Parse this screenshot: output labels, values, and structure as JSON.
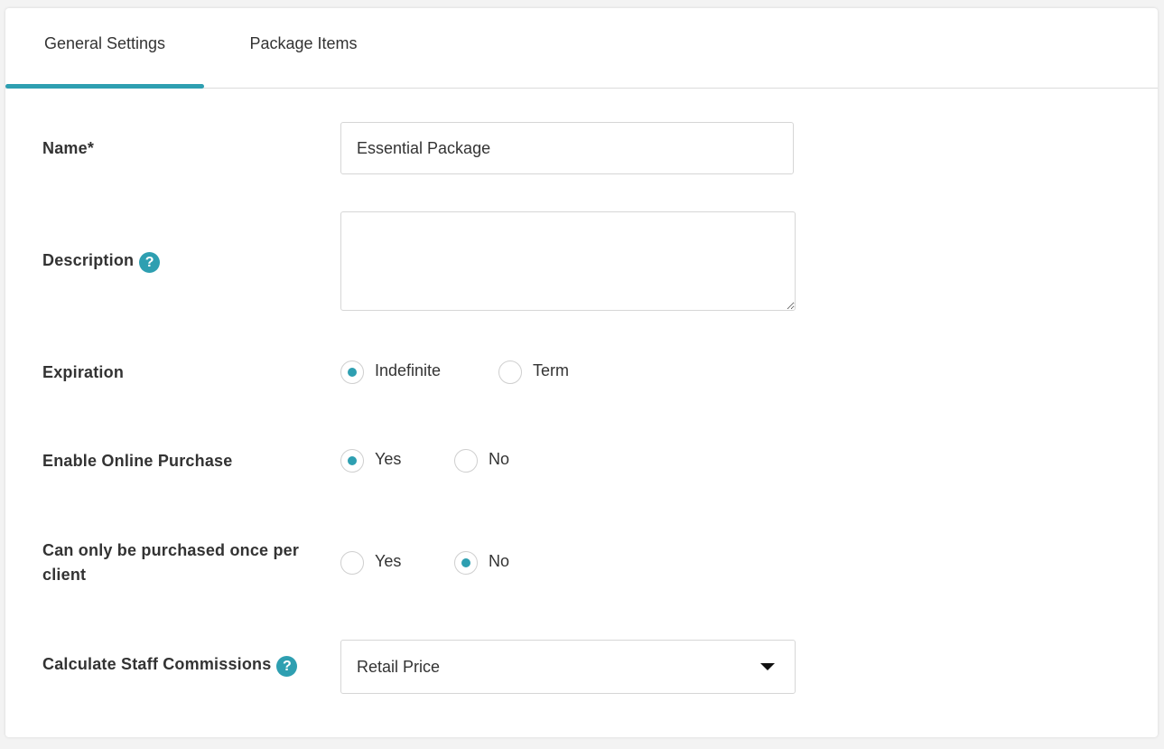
{
  "tabs": {
    "general": "General Settings",
    "items": "Package Items"
  },
  "form": {
    "name": {
      "label": "Name*",
      "value": "Essential Package"
    },
    "description": {
      "label": "Description",
      "value": ""
    },
    "expiration": {
      "label": "Expiration",
      "options": [
        "Indefinite",
        "Term"
      ],
      "selected": "Indefinite"
    },
    "online_purchase": {
      "label": "Enable Online Purchase",
      "options": [
        "Yes",
        "No"
      ],
      "selected": "Yes"
    },
    "once_per_client": {
      "label_line1": "Can only be purchased once per",
      "label_line2": "client",
      "options": [
        "Yes",
        "No"
      ],
      "selected": "No"
    },
    "commissions": {
      "label": "Calculate Staff Commissions",
      "value": "Retail Price"
    }
  },
  "icons": {
    "help": "question-mark-icon",
    "dropdown": "caret-down-icon"
  },
  "colors": {
    "accent": "#2e9fb1"
  }
}
